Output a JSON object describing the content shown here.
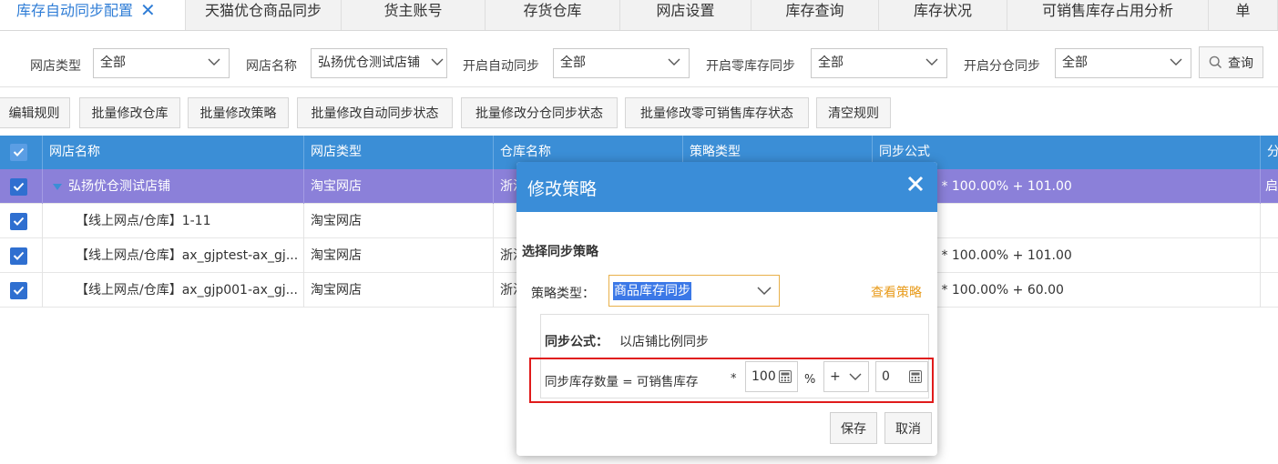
{
  "tabs": [
    {
      "label": "库存自动同步配置",
      "active": true
    },
    {
      "label": "天猫优仓商品同步"
    },
    {
      "label": "货主账号"
    },
    {
      "label": "存货仓库"
    },
    {
      "label": "网店设置"
    },
    {
      "label": "库存查询"
    },
    {
      "label": "库存状况"
    },
    {
      "label": "可销售库存占用分析"
    },
    {
      "label": "单"
    }
  ],
  "filters": {
    "shop_type": {
      "label": "网店类型",
      "value": "全部"
    },
    "shop_name": {
      "label": "网店名称",
      "value": "弘扬优仓测试店铺"
    },
    "auto_sync": {
      "label": "开启自动同步",
      "value": "全部"
    },
    "zero_stock_sync": {
      "label": "开启零库存同步",
      "value": "全部"
    },
    "split_warehouse_sync": {
      "label": "开启分仓同步",
      "value": "全部"
    },
    "query_label": "查询"
  },
  "toolbar": [
    "编辑规则",
    "批量修改仓库",
    "批量修改策略",
    "批量修改自动同步状态",
    "批量修改分仓同步状态",
    "批量修改零可销售库存状态",
    "清空规则"
  ],
  "grid": {
    "columns": [
      "网店名称",
      "网店类型",
      "仓库名称",
      "策略类型",
      "同步公式",
      "分"
    ],
    "rows": [
      {
        "name": "弘扬优仓测试店铺",
        "type": "淘宝网店",
        "warehouse": "浙江",
        "strategy": "",
        "formula": "存 * 100.00% + 101.00",
        "extra": "启",
        "selected": true
      },
      {
        "name": "【线上网点/仓库】1-11",
        "type": "淘宝网店",
        "warehouse": "",
        "strategy": "",
        "formula": "",
        "extra": ""
      },
      {
        "name": "【线上网点/仓库】ax_gjptest-ax_gj...",
        "type": "淘宝网店",
        "warehouse": "浙江",
        "strategy": "",
        "formula": "存 * 100.00% + 101.00",
        "extra": ""
      },
      {
        "name": "【线上网点/仓库】ax_gjp001-ax_gj...",
        "type": "淘宝网店",
        "warehouse": "浙江",
        "strategy": "",
        "formula": "存 * 100.00% + 60.00",
        "extra": ""
      }
    ]
  },
  "dialog": {
    "title": "修改策略",
    "section_title": "选择同步策略",
    "strategy_label": "策略类型：",
    "strategy_value": "商品库存同步",
    "view_link": "查看策略",
    "formula_title": "同步公式：",
    "formula_desc": "以店铺比例同步",
    "formula_expr": "同步库存数量 = 可销售库存",
    "multiply": "*",
    "percent_value": "100",
    "percent_sign": "%",
    "operator": "+",
    "add_value": "0",
    "save_label": "保存",
    "cancel_label": "取消"
  },
  "colors": {
    "header_blue": "#3b8ed6",
    "selected_row": "#8b80d9",
    "link_orange": "#e89b1b",
    "highlight_red": "#e01b1b"
  }
}
